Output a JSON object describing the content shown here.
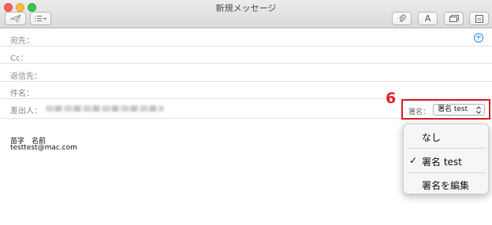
{
  "window": {
    "title": "新規メッセージ"
  },
  "toolbar": {
    "send_icon": "paper-plane-icon",
    "header_menu_icon": "list-icon",
    "attach_icon": "paperclip-icon",
    "format_glyph": "A",
    "photo_browser_icon": "photo-browser-icon",
    "stationery_icon": "stationery-icon"
  },
  "fields": {
    "to_label": "宛先：",
    "cc_label": "Cc：",
    "reply_to_label": "返信先：",
    "subject_label": "件名：",
    "from_label": "差出人："
  },
  "annotation": {
    "step_number": "6"
  },
  "signature": {
    "label": "署名：",
    "selected": "署名 test"
  },
  "message_body": {
    "name_line": "苗字　名前",
    "email_line": "testtest@mac.com"
  },
  "signature_menu": {
    "items": [
      "なし",
      "署名 test",
      "署名を編集"
    ],
    "checked_index": 1,
    "check_mark": "✓"
  },
  "colors": {
    "accent_blue": "#2c8cf0",
    "highlight_red": "#d9232a",
    "step_red": "#e8202a"
  }
}
